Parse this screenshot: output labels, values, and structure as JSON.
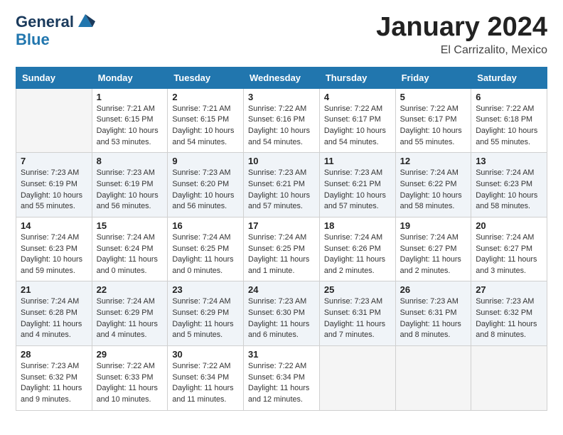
{
  "logo": {
    "line1": "General",
    "line2": "Blue"
  },
  "title": "January 2024",
  "location": "El Carrizalito, Mexico",
  "days_of_week": [
    "Sunday",
    "Monday",
    "Tuesday",
    "Wednesday",
    "Thursday",
    "Friday",
    "Saturday"
  ],
  "weeks": [
    [
      {
        "day": "",
        "sunrise": "",
        "sunset": "",
        "daylight": ""
      },
      {
        "day": "1",
        "sunrise": "Sunrise: 7:21 AM",
        "sunset": "Sunset: 6:15 PM",
        "daylight": "Daylight: 10 hours and 53 minutes."
      },
      {
        "day": "2",
        "sunrise": "Sunrise: 7:21 AM",
        "sunset": "Sunset: 6:15 PM",
        "daylight": "Daylight: 10 hours and 54 minutes."
      },
      {
        "day": "3",
        "sunrise": "Sunrise: 7:22 AM",
        "sunset": "Sunset: 6:16 PM",
        "daylight": "Daylight: 10 hours and 54 minutes."
      },
      {
        "day": "4",
        "sunrise": "Sunrise: 7:22 AM",
        "sunset": "Sunset: 6:17 PM",
        "daylight": "Daylight: 10 hours and 54 minutes."
      },
      {
        "day": "5",
        "sunrise": "Sunrise: 7:22 AM",
        "sunset": "Sunset: 6:17 PM",
        "daylight": "Daylight: 10 hours and 55 minutes."
      },
      {
        "day": "6",
        "sunrise": "Sunrise: 7:22 AM",
        "sunset": "Sunset: 6:18 PM",
        "daylight": "Daylight: 10 hours and 55 minutes."
      }
    ],
    [
      {
        "day": "7",
        "sunrise": "Sunrise: 7:23 AM",
        "sunset": "Sunset: 6:19 PM",
        "daylight": "Daylight: 10 hours and 55 minutes."
      },
      {
        "day": "8",
        "sunrise": "Sunrise: 7:23 AM",
        "sunset": "Sunset: 6:19 PM",
        "daylight": "Daylight: 10 hours and 56 minutes."
      },
      {
        "day": "9",
        "sunrise": "Sunrise: 7:23 AM",
        "sunset": "Sunset: 6:20 PM",
        "daylight": "Daylight: 10 hours and 56 minutes."
      },
      {
        "day": "10",
        "sunrise": "Sunrise: 7:23 AM",
        "sunset": "Sunset: 6:21 PM",
        "daylight": "Daylight: 10 hours and 57 minutes."
      },
      {
        "day": "11",
        "sunrise": "Sunrise: 7:23 AM",
        "sunset": "Sunset: 6:21 PM",
        "daylight": "Daylight: 10 hours and 57 minutes."
      },
      {
        "day": "12",
        "sunrise": "Sunrise: 7:24 AM",
        "sunset": "Sunset: 6:22 PM",
        "daylight": "Daylight: 10 hours and 58 minutes."
      },
      {
        "day": "13",
        "sunrise": "Sunrise: 7:24 AM",
        "sunset": "Sunset: 6:23 PM",
        "daylight": "Daylight: 10 hours and 58 minutes."
      }
    ],
    [
      {
        "day": "14",
        "sunrise": "Sunrise: 7:24 AM",
        "sunset": "Sunset: 6:23 PM",
        "daylight": "Daylight: 10 hours and 59 minutes."
      },
      {
        "day": "15",
        "sunrise": "Sunrise: 7:24 AM",
        "sunset": "Sunset: 6:24 PM",
        "daylight": "Daylight: 11 hours and 0 minutes."
      },
      {
        "day": "16",
        "sunrise": "Sunrise: 7:24 AM",
        "sunset": "Sunset: 6:25 PM",
        "daylight": "Daylight: 11 hours and 0 minutes."
      },
      {
        "day": "17",
        "sunrise": "Sunrise: 7:24 AM",
        "sunset": "Sunset: 6:25 PM",
        "daylight": "Daylight: 11 hours and 1 minute."
      },
      {
        "day": "18",
        "sunrise": "Sunrise: 7:24 AM",
        "sunset": "Sunset: 6:26 PM",
        "daylight": "Daylight: 11 hours and 2 minutes."
      },
      {
        "day": "19",
        "sunrise": "Sunrise: 7:24 AM",
        "sunset": "Sunset: 6:27 PM",
        "daylight": "Daylight: 11 hours and 2 minutes."
      },
      {
        "day": "20",
        "sunrise": "Sunrise: 7:24 AM",
        "sunset": "Sunset: 6:27 PM",
        "daylight": "Daylight: 11 hours and 3 minutes."
      }
    ],
    [
      {
        "day": "21",
        "sunrise": "Sunrise: 7:24 AM",
        "sunset": "Sunset: 6:28 PM",
        "daylight": "Daylight: 11 hours and 4 minutes."
      },
      {
        "day": "22",
        "sunrise": "Sunrise: 7:24 AM",
        "sunset": "Sunset: 6:29 PM",
        "daylight": "Daylight: 11 hours and 4 minutes."
      },
      {
        "day": "23",
        "sunrise": "Sunrise: 7:24 AM",
        "sunset": "Sunset: 6:29 PM",
        "daylight": "Daylight: 11 hours and 5 minutes."
      },
      {
        "day": "24",
        "sunrise": "Sunrise: 7:23 AM",
        "sunset": "Sunset: 6:30 PM",
        "daylight": "Daylight: 11 hours and 6 minutes."
      },
      {
        "day": "25",
        "sunrise": "Sunrise: 7:23 AM",
        "sunset": "Sunset: 6:31 PM",
        "daylight": "Daylight: 11 hours and 7 minutes."
      },
      {
        "day": "26",
        "sunrise": "Sunrise: 7:23 AM",
        "sunset": "Sunset: 6:31 PM",
        "daylight": "Daylight: 11 hours and 8 minutes."
      },
      {
        "day": "27",
        "sunrise": "Sunrise: 7:23 AM",
        "sunset": "Sunset: 6:32 PM",
        "daylight": "Daylight: 11 hours and 8 minutes."
      }
    ],
    [
      {
        "day": "28",
        "sunrise": "Sunrise: 7:23 AM",
        "sunset": "Sunset: 6:32 PM",
        "daylight": "Daylight: 11 hours and 9 minutes."
      },
      {
        "day": "29",
        "sunrise": "Sunrise: 7:22 AM",
        "sunset": "Sunset: 6:33 PM",
        "daylight": "Daylight: 11 hours and 10 minutes."
      },
      {
        "day": "30",
        "sunrise": "Sunrise: 7:22 AM",
        "sunset": "Sunset: 6:34 PM",
        "daylight": "Daylight: 11 hours and 11 minutes."
      },
      {
        "day": "31",
        "sunrise": "Sunrise: 7:22 AM",
        "sunset": "Sunset: 6:34 PM",
        "daylight": "Daylight: 11 hours and 12 minutes."
      },
      {
        "day": "",
        "sunrise": "",
        "sunset": "",
        "daylight": ""
      },
      {
        "day": "",
        "sunrise": "",
        "sunset": "",
        "daylight": ""
      },
      {
        "day": "",
        "sunrise": "",
        "sunset": "",
        "daylight": ""
      }
    ]
  ]
}
